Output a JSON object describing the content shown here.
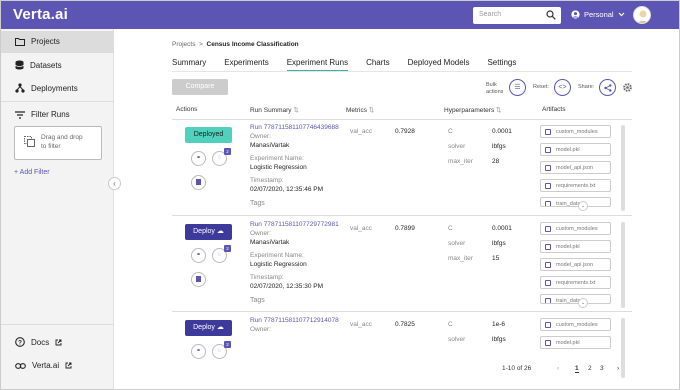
{
  "app": {
    "logo": "Verta.ai",
    "search_placeholder": "Search",
    "workspace": "Personal"
  },
  "sidebar": {
    "projects": "Projects",
    "datasets": "Datasets",
    "deployments": "Deployments",
    "filter_runs": "Filter Runs",
    "drop_text_1": "Drag and drop",
    "drop_text_2": "to filter",
    "add_filter": "+ Add Filter",
    "docs": "Docs",
    "verta": "Verta.ai"
  },
  "breadcrumb": {
    "root": "Projects",
    "sep": ">",
    "current": "Census Income Classification"
  },
  "tabs": [
    "Summary",
    "Experiments",
    "Experiment Runs",
    "Charts",
    "Deployed Models",
    "Settings"
  ],
  "toolbar": {
    "compare": "Compare",
    "bulk_1": "Bulk",
    "bulk_2": "actions",
    "reset": "Reset:",
    "share": "Share:"
  },
  "columns": {
    "actions": "Actions",
    "run_summary": "Run Summary",
    "metrics": "Metrics",
    "hyperparameters": "Hyperparameters",
    "artifacts": "Artifacts"
  },
  "runs": [
    {
      "action": "Deployed",
      "badge": "2",
      "id": "Run 778711581107746439688",
      "owner_label": "Owner:",
      "owner": "ManasiVartak",
      "exp_label": "Experiment Name:",
      "exp": "Logistic Regression",
      "ts_label": "Timestamp:",
      "ts": "02/07/2020, 12:35:46 PM",
      "tags": "Tags",
      "metric": "val_acc",
      "metric_val": "0.7928",
      "hp": [
        {
          "k": "C",
          "v": "0.0001"
        },
        {
          "k": "solver",
          "v": "lbfgs"
        },
        {
          "k": "max_iter",
          "v": "28"
        }
      ],
      "artifacts": [
        "custom_modules",
        "model.pkl",
        "model_api.json",
        "requirements.txt",
        "train_data"
      ]
    },
    {
      "action": "Deploy",
      "badge": "2",
      "id": "Run 778711581107729772981",
      "owner_label": "Owner:",
      "owner": "ManasiVartak",
      "exp_label": "Experiment Name:",
      "exp": "Logistic Regression",
      "ts_label": "Timestamp:",
      "ts": "02/07/2020, 12:35:30 PM",
      "tags": "Tags",
      "metric": "val_acc",
      "metric_val": "0.7899",
      "hp": [
        {
          "k": "C",
          "v": "0.0001"
        },
        {
          "k": "solver",
          "v": "lbfgs"
        },
        {
          "k": "max_iter",
          "v": "15"
        }
      ],
      "artifacts": [
        "custom_modules",
        "model.pkl",
        "model_api.json",
        "requirements.txt",
        "train_data"
      ]
    },
    {
      "action": "Deploy",
      "badge": "2",
      "id": "Run 778711581107712914078",
      "owner_label": "Owner:",
      "owner": "",
      "exp_label": "",
      "exp": "",
      "ts_label": "",
      "ts": "",
      "tags": "",
      "metric": "val_acc",
      "metric_val": "0.7825",
      "hp": [
        {
          "k": "C",
          "v": "1e-6"
        },
        {
          "k": "solver",
          "v": "lbfgs"
        }
      ],
      "artifacts": [
        "custom_modules",
        "model.pkl"
      ]
    }
  ],
  "pagination": {
    "range": "1-10 of 26",
    "pages": [
      "1",
      "2",
      "3"
    ],
    "prev": "‹",
    "next": "›"
  },
  "colors": {
    "brand": "#5c55b4",
    "deployed": "#4fd1bd",
    "accent": "#3bb3a3"
  }
}
